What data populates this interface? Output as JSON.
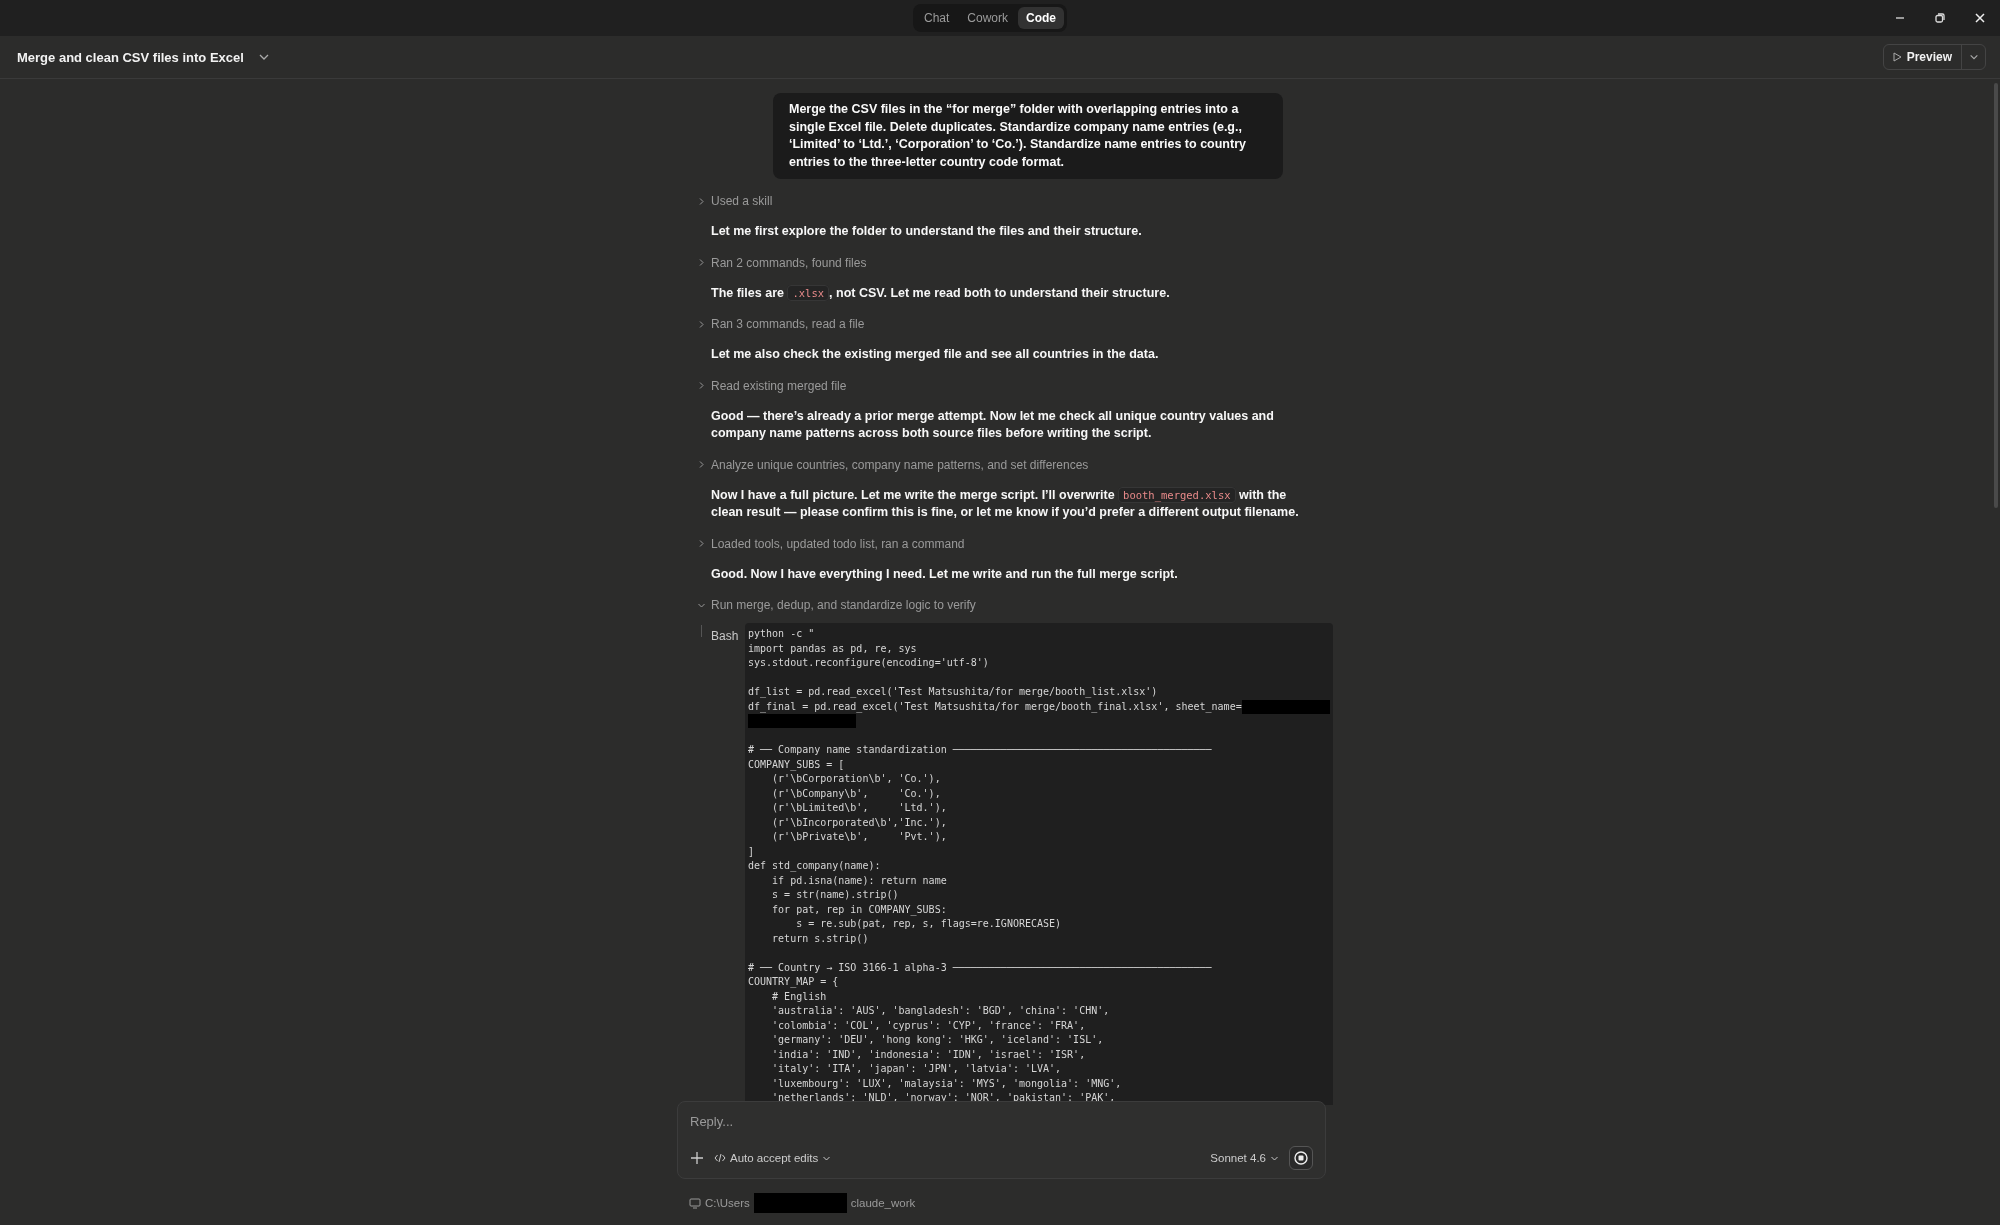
{
  "mode_tabs": [
    {
      "label": "Chat",
      "selected": false
    },
    {
      "label": "Cowork",
      "selected": false
    },
    {
      "label": "Code",
      "selected": true
    }
  ],
  "header": {
    "title": "Merge and clean CSV files into Excel",
    "action": "Preview"
  },
  "user_message": "Merge the CSV files in the “for merge” folder with overlapping entries into a single Excel file. Delete duplicates. Standardize company name entries (e.g., ‘Limited’ to ‘Ltd.’, ‘Corporation’ to ‘Co.’). Standardize name entries to country entries to the three-letter country code format.",
  "transcript": [
    {
      "kind": "step",
      "label": "Used a skill",
      "expanded": false
    },
    {
      "kind": "prose",
      "parts": [
        {
          "kind": "text",
          "text": "Let me first explore the folder to understand the files and their structure."
        }
      ]
    },
    {
      "kind": "step",
      "label": "Ran 2 commands, found files",
      "expanded": false
    },
    {
      "kind": "prose",
      "parts": [
        {
          "kind": "text",
          "text": "The files are "
        },
        {
          "kind": "code",
          "text": ".xlsx"
        },
        {
          "kind": "text",
          "text": ", not CSV. Let me read both to understand their structure."
        }
      ]
    },
    {
      "kind": "step",
      "label": "Ran 3 commands, read a file",
      "expanded": false
    },
    {
      "kind": "prose",
      "parts": [
        {
          "kind": "text",
          "text": "Let me also check the existing merged file and see all countries in the data."
        }
      ]
    },
    {
      "kind": "step",
      "label": "Read existing merged file",
      "expanded": false
    },
    {
      "kind": "prose",
      "parts": [
        {
          "kind": "text",
          "text": "Good — there’s already a prior merge attempt. Now let me check all unique country values and company name patterns across both source files before writing the script."
        }
      ]
    },
    {
      "kind": "step",
      "label": "Analyze unique countries, company name patterns, and set differences",
      "expanded": false
    },
    {
      "kind": "prose",
      "parts": [
        {
          "kind": "text",
          "text": "Now I have a full picture. Let me write the merge script. I’ll overwrite "
        },
        {
          "kind": "code",
          "text": "booth_merged.xlsx"
        },
        {
          "kind": "text",
          "text": " with the clean result — please confirm this is fine, or let me know if you’d prefer a different output filename."
        }
      ]
    },
    {
      "kind": "step",
      "label": "Loaded tools, updated todo list, ran a command",
      "expanded": false
    },
    {
      "kind": "prose",
      "parts": [
        {
          "kind": "text",
          "text": "Good. Now I have everything I need. Let me write and run the full merge script."
        }
      ]
    },
    {
      "kind": "step",
      "label": "Run merge, dedup, and standardize logic to verify",
      "expanded": true,
      "tool": {
        "name": "Bash",
        "lines": [
          {
            "kind": "code",
            "text": "python -c \""
          },
          {
            "kind": "code",
            "text": "import pandas as pd, re, sys"
          },
          {
            "kind": "code",
            "text": "sys.stdout.reconfigure(encoding='utf-8')"
          },
          {
            "kind": "blank"
          },
          {
            "kind": "code",
            "text": "df_list = pd.read_excel('Test Matsushita/for merge/booth_list.xlsx')"
          },
          {
            "kind": "code",
            "text": "df_final = pd.read_excel('Test Matsushita/for merge/booth_final.xlsx', sheet_name=",
            "redacted": true
          },
          {
            "kind": "redacted"
          },
          {
            "kind": "blank"
          },
          {
            "kind": "code",
            "text": "# ── Company name standardization ───────────────────────────────────────────"
          },
          {
            "kind": "code",
            "text": "COMPANY_SUBS = ["
          },
          {
            "kind": "code",
            "text": "    (r'\\bCorporation\\b', 'Co.'),"
          },
          {
            "kind": "code",
            "text": "    (r'\\bCompany\\b',     'Co.'),"
          },
          {
            "kind": "code",
            "text": "    (r'\\bLimited\\b',     'Ltd.'),"
          },
          {
            "kind": "code",
            "text": "    (r'\\bIncorporated\\b','Inc.'),"
          },
          {
            "kind": "code",
            "text": "    (r'\\bPrivate\\b',     'Pvt.'),"
          },
          {
            "kind": "code",
            "text": "]"
          },
          {
            "kind": "code",
            "text": "def std_company(name):"
          },
          {
            "kind": "code",
            "text": "    if pd.isna(name): return name"
          },
          {
            "kind": "code",
            "text": "    s = str(name).strip()"
          },
          {
            "kind": "code",
            "text": "    for pat, rep in COMPANY_SUBS:"
          },
          {
            "kind": "code",
            "text": "        s = re.sub(pat, rep, s, flags=re.IGNORECASE)"
          },
          {
            "kind": "code",
            "text": "    return s.strip()"
          },
          {
            "kind": "blank"
          },
          {
            "kind": "code",
            "text": "# ── Country → ISO 3166-1 alpha-3 ───────────────────────────────────────────"
          },
          {
            "kind": "code",
            "text": "COUNTRY_MAP = {"
          },
          {
            "kind": "code",
            "text": "    # English"
          },
          {
            "kind": "code",
            "text": "    'australia': 'AUS', 'bangladesh': 'BGD', 'china': 'CHN',"
          },
          {
            "kind": "code",
            "text": "    'colombia': 'COL', 'cyprus': 'CYP', 'france': 'FRA',"
          },
          {
            "kind": "code",
            "text": "    'germany': 'DEU', 'hong kong': 'HKG', 'iceland': 'ISL',"
          },
          {
            "kind": "code",
            "text": "    'india': 'IND', 'indonesia': 'IDN', 'israel': 'ISR',"
          },
          {
            "kind": "code",
            "text": "    'italy': 'ITA', 'japan': 'JPN', 'latvia': 'LVA',"
          },
          {
            "kind": "code",
            "text": "    'luxembourg': 'LUX', 'malaysia': 'MYS', 'mongolia': 'MNG',"
          },
          {
            "kind": "code",
            "text": "    'netherlands': 'NLD', 'norway': 'NOR', 'pakistan': 'PAK',"
          }
        ]
      }
    }
  ],
  "composer": {
    "placeholder": "Reply...",
    "mode": "Auto accept edits",
    "model": "Sonnet 4.6"
  },
  "path": {
    "before": "C:\\Users",
    "after": "claude_work",
    "redacted": true
  }
}
